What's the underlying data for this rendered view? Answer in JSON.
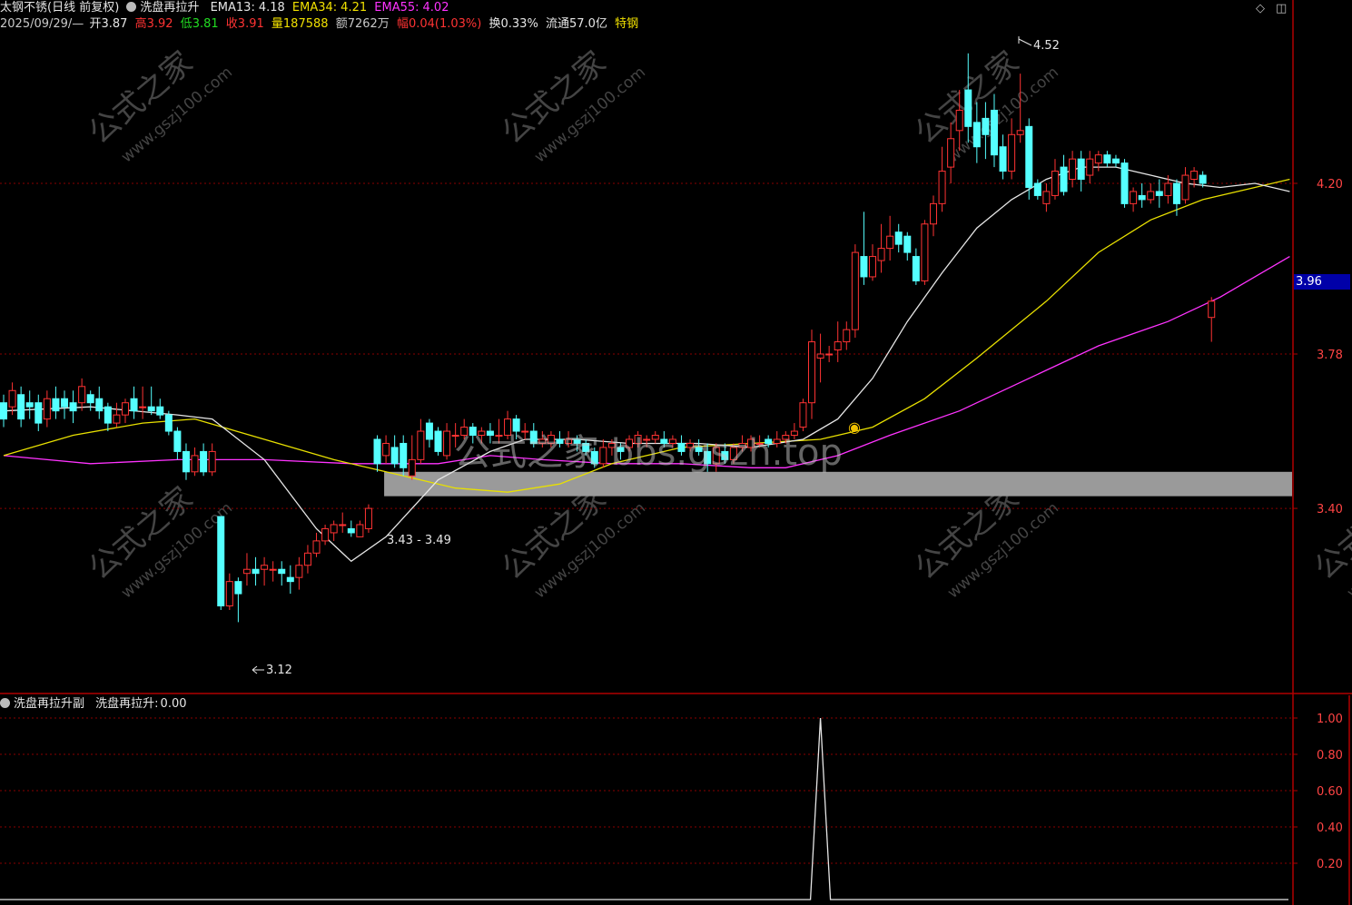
{
  "header": {
    "stock_name": "太钢不锈(日线 前复权)",
    "indicator_name": "洗盘再拉升",
    "ema13_label": "EMA13:",
    "ema13_value": "4.18",
    "ema34_label": "EMA34:",
    "ema34_value": "4.21",
    "ema55_label": "EMA55:",
    "ema55_value": "4.02"
  },
  "quote": {
    "date": "2025/09/29/—",
    "open_label": "开",
    "open": "3.87",
    "high_label": "高",
    "high": "3.92",
    "low_label": "低",
    "low": "3.81",
    "close_label": "收",
    "close": "3.91",
    "volume_label": "量",
    "volume": "187588",
    "amount_label": "额",
    "amount": "7262万",
    "change_label": "幅",
    "change": "0.04(1.03%)",
    "turnover_label": "换",
    "turnover": "0.33%",
    "float_label": "流通",
    "float_cap": "57.0亿",
    "sector": "特钢"
  },
  "sub_header": {
    "title": "洗盘再拉升副",
    "indicator": "洗盘再拉升:",
    "value": "0.00"
  },
  "price_axis": {
    "ticks": [
      "4.20",
      "3.78",
      "3.40"
    ],
    "badge": "3.96"
  },
  "sub_axis": {
    "ticks": [
      "1.00",
      "0.80",
      "0.60",
      "0.40",
      "0.20"
    ]
  },
  "annotations": {
    "high_mark": "4.52",
    "low_mark": "3.12",
    "zone_label": "3.43 - 3.49"
  },
  "watermark": {
    "center": "公式之家 bbs.gszh.top",
    "tile_cn": "公式之家",
    "tile_en": "www.gszj100.com"
  },
  "colors": {
    "up": "#ff3333",
    "down": "#55ffff",
    "ema13": "#e6e6e6",
    "ema34": "#e8e000",
    "ema55": "#ff33ff",
    "zone": "#9a9a9a",
    "grid": "#8a0000",
    "axis": "#b00000"
  },
  "chart_data": {
    "type": "candlestick",
    "period": "daily",
    "last_date": "2025/09/29",
    "price_ylim": [
      3.12,
      4.52
    ],
    "zone": [
      3.43,
      3.49
    ],
    "candles": [
      [
        3.66,
        3.62,
        3.68,
        3.6
      ],
      [
        3.65,
        3.69,
        3.71,
        3.63
      ],
      [
        3.68,
        3.62,
        3.7,
        3.6
      ],
      [
        3.66,
        3.65,
        3.69,
        3.62
      ],
      [
        3.66,
        3.61,
        3.68,
        3.59
      ],
      [
        3.62,
        3.67,
        3.69,
        3.6
      ],
      [
        3.67,
        3.64,
        3.7,
        3.62
      ],
      [
        3.67,
        3.65,
        3.69,
        3.62
      ],
      [
        3.66,
        3.64,
        3.69,
        3.61
      ],
      [
        3.66,
        3.7,
        3.72,
        3.64
      ],
      [
        3.68,
        3.66,
        3.69,
        3.64
      ],
      [
        3.67,
        3.64,
        3.7,
        3.62
      ],
      [
        3.65,
        3.61,
        3.66,
        3.59
      ],
      [
        3.61,
        3.63,
        3.66,
        3.6
      ],
      [
        3.63,
        3.66,
        3.67,
        3.61
      ],
      [
        3.67,
        3.64,
        3.7,
        3.62
      ],
      [
        3.65,
        3.65,
        3.7,
        3.62
      ],
      [
        3.65,
        3.64,
        3.7,
        3.63
      ],
      [
        3.65,
        3.63,
        3.67,
        3.62
      ],
      [
        3.63,
        3.59,
        3.64,
        3.58
      ],
      [
        3.59,
        3.54,
        3.6,
        3.52
      ],
      [
        3.54,
        3.49,
        3.56,
        3.47
      ],
      [
        3.49,
        3.53,
        3.55,
        3.48
      ],
      [
        3.54,
        3.49,
        3.56,
        3.48
      ],
      [
        3.49,
        3.54,
        3.56,
        3.48
      ],
      [
        3.38,
        3.16,
        3.38,
        3.15
      ],
      [
        3.16,
        3.22,
        3.24,
        3.15
      ],
      [
        3.22,
        3.19,
        3.23,
        3.12
      ],
      [
        3.24,
        3.25,
        3.29,
        3.21
      ],
      [
        3.25,
        3.24,
        3.28,
        3.21
      ],
      [
        3.25,
        3.26,
        3.28,
        3.21
      ],
      [
        3.25,
        3.25,
        3.27,
        3.22
      ],
      [
        3.25,
        3.24,
        3.27,
        3.21
      ],
      [
        3.23,
        3.22,
        3.26,
        3.19
      ],
      [
        3.23,
        3.26,
        3.28,
        3.2
      ],
      [
        3.26,
        3.29,
        3.31,
        3.24
      ],
      [
        3.29,
        3.32,
        3.34,
        3.28
      ],
      [
        3.32,
        3.35,
        3.36,
        3.31
      ],
      [
        3.34,
        3.36,
        3.37,
        3.32
      ],
      [
        3.36,
        3.36,
        3.39,
        3.34
      ],
      [
        3.35,
        3.34,
        3.37,
        3.33
      ],
      [
        3.33,
        3.36,
        3.37,
        3.33
      ],
      [
        3.35,
        3.4,
        3.41,
        3.34
      ],
      [
        3.57,
        3.51,
        3.58,
        3.49
      ],
      [
        3.53,
        3.56,
        3.58,
        3.51
      ],
      [
        3.55,
        3.51,
        3.58,
        3.5
      ],
      [
        3.56,
        3.5,
        3.58,
        3.48
      ],
      [
        3.48,
        3.52,
        3.58,
        3.47
      ],
      [
        3.52,
        3.59,
        3.62,
        3.51
      ],
      [
        3.61,
        3.57,
        3.62,
        3.55
      ],
      [
        3.59,
        3.54,
        3.6,
        3.53
      ],
      [
        3.53,
        3.59,
        3.61,
        3.52
      ],
      [
        3.58,
        3.58,
        3.61,
        3.55
      ],
      [
        3.58,
        3.6,
        3.62,
        3.57
      ],
      [
        3.6,
        3.58,
        3.61,
        3.56
      ],
      [
        3.58,
        3.59,
        3.6,
        3.56
      ],
      [
        3.59,
        3.58,
        3.61,
        3.56
      ],
      [
        3.58,
        3.58,
        3.62,
        3.56
      ],
      [
        3.58,
        3.62,
        3.64,
        3.57
      ],
      [
        3.62,
        3.59,
        3.63,
        3.57
      ],
      [
        3.59,
        3.59,
        3.61,
        3.57
      ],
      [
        3.59,
        3.56,
        3.61,
        3.55
      ],
      [
        3.56,
        3.57,
        3.59,
        3.55
      ],
      [
        3.56,
        3.58,
        3.59,
        3.55
      ],
      [
        3.57,
        3.56,
        3.59,
        3.55
      ],
      [
        3.56,
        3.57,
        3.59,
        3.55
      ],
      [
        3.57,
        3.56,
        3.58,
        3.54
      ],
      [
        3.56,
        3.54,
        3.57,
        3.53
      ],
      [
        3.54,
        3.51,
        3.55,
        3.5
      ],
      [
        3.51,
        3.55,
        3.57,
        3.5
      ],
      [
        3.55,
        3.56,
        3.57,
        3.53
      ],
      [
        3.55,
        3.54,
        3.56,
        3.52
      ],
      [
        3.55,
        3.57,
        3.58,
        3.54
      ],
      [
        3.56,
        3.58,
        3.59,
        3.55
      ],
      [
        3.57,
        3.57,
        3.58,
        3.55
      ],
      [
        3.57,
        3.58,
        3.59,
        3.56
      ],
      [
        3.57,
        3.56,
        3.59,
        3.55
      ],
      [
        3.56,
        3.57,
        3.58,
        3.55
      ],
      [
        3.56,
        3.54,
        3.58,
        3.53
      ],
      [
        3.55,
        3.56,
        3.57,
        3.54
      ],
      [
        3.55,
        3.54,
        3.57,
        3.53
      ],
      [
        3.54,
        3.51,
        3.56,
        3.49
      ],
      [
        3.51,
        3.55,
        3.56,
        3.49
      ],
      [
        3.54,
        3.52,
        3.56,
        3.51
      ],
      [
        3.52,
        3.55,
        3.56,
        3.51
      ],
      [
        3.55,
        3.56,
        3.58,
        3.54
      ],
      [
        3.55,
        3.57,
        3.58,
        3.54
      ],
      [
        3.56,
        3.56,
        3.58,
        3.55
      ],
      [
        3.57,
        3.56,
        3.58,
        3.55
      ],
      [
        3.56,
        3.57,
        3.59,
        3.55
      ],
      [
        3.57,
        3.58,
        3.59,
        3.56
      ],
      [
        3.58,
        3.59,
        3.61,
        3.57
      ],
      [
        3.6,
        3.66,
        3.67,
        3.59
      ],
      [
        3.66,
        3.81,
        3.84,
        3.62
      ],
      [
        3.77,
        3.78,
        3.83,
        3.71
      ],
      [
        3.78,
        3.78,
        3.8,
        3.76
      ],
      [
        3.79,
        3.81,
        3.86,
        3.76
      ],
      [
        3.81,
        3.84,
        3.86,
        3.79
      ],
      [
        3.84,
        4.03,
        4.05,
        3.82
      ],
      [
        4.02,
        3.97,
        4.13,
        3.95
      ],
      [
        3.97,
        4.02,
        4.05,
        3.96
      ],
      [
        4.01,
        4.04,
        4.1,
        3.98
      ],
      [
        4.04,
        4.07,
        4.12,
        4.01
      ],
      [
        4.08,
        4.05,
        4.1,
        4.03
      ],
      [
        4.07,
        4.03,
        4.08,
        4.01
      ],
      [
        4.02,
        3.96,
        4.04,
        3.95
      ],
      [
        3.96,
        4.1,
        4.11,
        3.95
      ],
      [
        4.1,
        4.15,
        4.17,
        4.07
      ],
      [
        4.15,
        4.23,
        4.29,
        4.13
      ],
      [
        4.24,
        4.31,
        4.35,
        4.2
      ],
      [
        4.33,
        4.38,
        4.43,
        4.28
      ],
      [
        4.43,
        4.34,
        4.52,
        4.3
      ],
      [
        4.35,
        4.29,
        4.4,
        4.25
      ],
      [
        4.36,
        4.32,
        4.4,
        4.26
      ],
      [
        4.38,
        4.27,
        4.42,
        4.24
      ],
      [
        4.29,
        4.23,
        4.32,
        4.21
      ],
      [
        4.23,
        4.32,
        4.36,
        4.21
      ],
      [
        4.32,
        4.33,
        4.47,
        4.3
      ],
      [
        4.34,
        4.19,
        4.36,
        4.16
      ],
      [
        4.2,
        4.17,
        4.21,
        4.16
      ],
      [
        4.15,
        4.18,
        4.2,
        4.13
      ],
      [
        4.17,
        4.23,
        4.26,
        4.16
      ],
      [
        4.24,
        4.18,
        4.27,
        4.17
      ],
      [
        4.21,
        4.26,
        4.28,
        4.19
      ],
      [
        4.26,
        4.21,
        4.28,
        4.18
      ],
      [
        4.22,
        4.26,
        4.28,
        4.2
      ],
      [
        4.25,
        4.27,
        4.28,
        4.23
      ],
      [
        4.27,
        4.25,
        4.28,
        4.24
      ],
      [
        4.26,
        4.25,
        4.27,
        4.24
      ],
      [
        4.25,
        4.15,
        4.26,
        4.14
      ],
      [
        4.15,
        4.18,
        4.19,
        4.13
      ],
      [
        4.17,
        4.16,
        4.2,
        4.14
      ],
      [
        4.16,
        4.18,
        4.2,
        4.15
      ],
      [
        4.18,
        4.17,
        4.21,
        4.14
      ],
      [
        4.17,
        4.2,
        4.22,
        4.15
      ],
      [
        4.2,
        4.15,
        4.21,
        4.12
      ],
      [
        4.16,
        4.22,
        4.24,
        4.15
      ],
      [
        4.21,
        4.23,
        4.24,
        4.19
      ],
      [
        4.22,
        4.2,
        4.23,
        4.19
      ],
      [
        3.87,
        3.91,
        3.92,
        3.81
      ]
    ],
    "ema13": [
      [
        0,
        3.64
      ],
      [
        10,
        3.65
      ],
      [
        20,
        3.63
      ],
      [
        24,
        3.62
      ],
      [
        30,
        3.52
      ],
      [
        36,
        3.35
      ],
      [
        40,
        3.27
      ],
      [
        44,
        3.33
      ],
      [
        50,
        3.47
      ],
      [
        56,
        3.54
      ],
      [
        60,
        3.57
      ],
      [
        66,
        3.57
      ],
      [
        72,
        3.56
      ],
      [
        80,
        3.56
      ],
      [
        86,
        3.55
      ],
      [
        92,
        3.57
      ],
      [
        96,
        3.62
      ],
      [
        100,
        3.72
      ],
      [
        104,
        3.86
      ],
      [
        108,
        3.98
      ],
      [
        112,
        4.09
      ],
      [
        116,
        4.16
      ],
      [
        120,
        4.21
      ],
      [
        124,
        4.24
      ],
      [
        128,
        4.24
      ],
      [
        132,
        4.22
      ],
      [
        136,
        4.2
      ],
      [
        140,
        4.19
      ],
      [
        144,
        4.2
      ],
      [
        148,
        4.18
      ]
    ],
    "ema34": [
      [
        0,
        3.53
      ],
      [
        8,
        3.58
      ],
      [
        16,
        3.61
      ],
      [
        22,
        3.62
      ],
      [
        30,
        3.57
      ],
      [
        38,
        3.52
      ],
      [
        44,
        3.49
      ],
      [
        52,
        3.45
      ],
      [
        58,
        3.44
      ],
      [
        64,
        3.46
      ],
      [
        70,
        3.51
      ],
      [
        78,
        3.55
      ],
      [
        86,
        3.56
      ],
      [
        94,
        3.57
      ],
      [
        100,
        3.6
      ],
      [
        106,
        3.67
      ],
      [
        112,
        3.77
      ],
      [
        120,
        3.91
      ],
      [
        126,
        4.03
      ],
      [
        132,
        4.11
      ],
      [
        138,
        4.16
      ],
      [
        144,
        4.19
      ],
      [
        148,
        4.21
      ]
    ],
    "ema55": [
      [
        0,
        3.53
      ],
      [
        10,
        3.51
      ],
      [
        20,
        3.52
      ],
      [
        30,
        3.52
      ],
      [
        40,
        3.51
      ],
      [
        50,
        3.51
      ],
      [
        56,
        3.53
      ],
      [
        62,
        3.52
      ],
      [
        70,
        3.51
      ],
      [
        78,
        3.51
      ],
      [
        86,
        3.5
      ],
      [
        90,
        3.5
      ],
      [
        96,
        3.53
      ],
      [
        102,
        3.58
      ],
      [
        110,
        3.64
      ],
      [
        118,
        3.72
      ],
      [
        126,
        3.8
      ],
      [
        134,
        3.86
      ],
      [
        140,
        3.92
      ],
      [
        148,
        4.02
      ]
    ],
    "signal": {
      "ylim": [
        0,
        1
      ],
      "ticks": [
        1.0,
        0.8,
        0.6,
        0.4,
        0.2
      ],
      "peak_index": 94,
      "peak_value": 1.0
    }
  }
}
